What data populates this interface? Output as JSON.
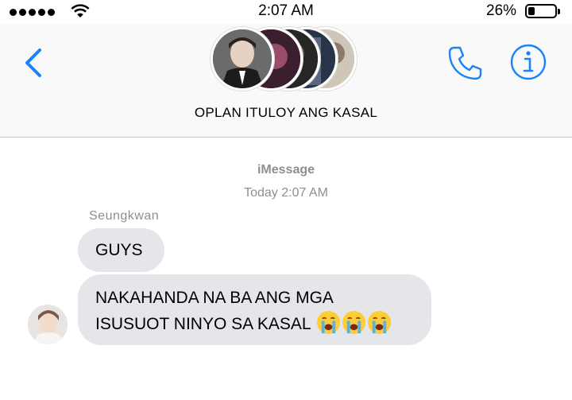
{
  "status_bar": {
    "time": "2:07 AM",
    "battery_percent": "26%",
    "battery_level": 0.26,
    "signal_dots": 5,
    "wifi_icon": "wifi-icon"
  },
  "header": {
    "group_name": "OPLAN ITULOY ANG KASAL",
    "back_icon": "chevron-left-icon",
    "call_icon": "phone-icon",
    "info_icon": "info-icon",
    "accent_color": "#1a82fb",
    "avatar_count": 5
  },
  "conversation": {
    "service_label": "iMessage",
    "timestamp": "Today 2:07 AM",
    "sender": "Seungkwan",
    "bubble_color": "#e5e5ea",
    "messages": [
      {
        "line1": "GUYS"
      },
      {
        "line1": "NAKAHANDA NA BA ANG MGA",
        "line2": "ISUSUOT NINYO SA KASAL",
        "emoji": [
          "crying-face-emoji",
          "crying-face-emoji",
          "crying-face-emoji"
        ]
      }
    ]
  }
}
